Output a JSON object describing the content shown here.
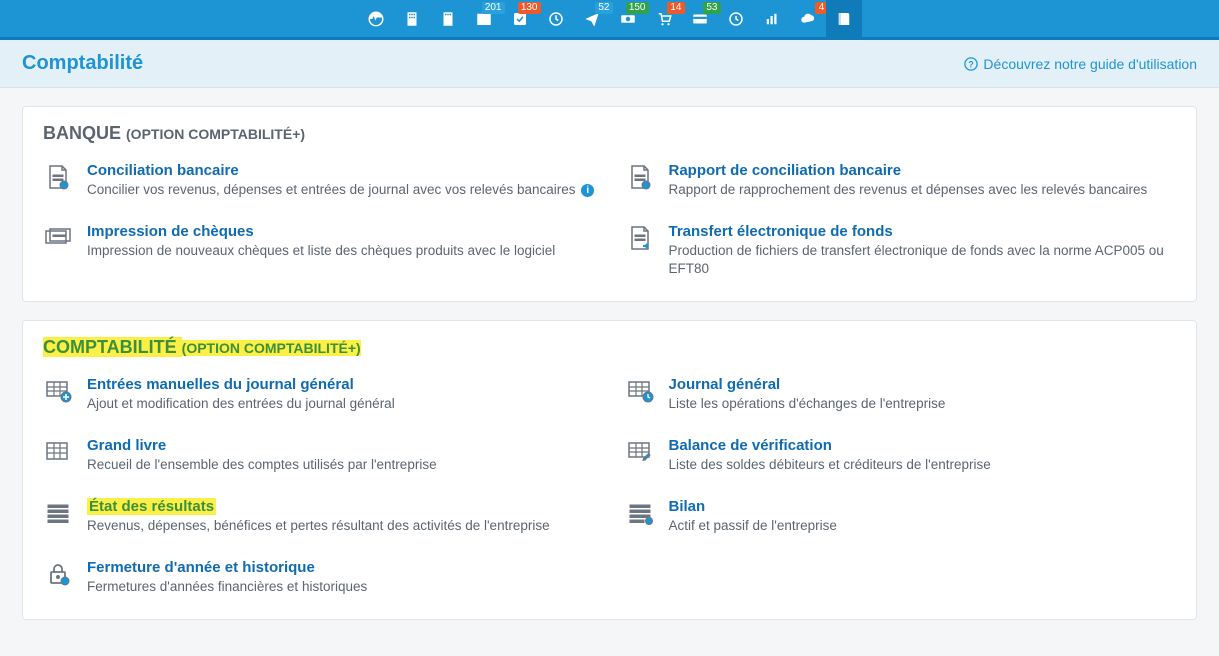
{
  "topbar": {
    "items": [
      {
        "icon": "dashboard-icon",
        "badge": null
      },
      {
        "icon": "building-icon",
        "badge": null
      },
      {
        "icon": "building2-icon",
        "badge": null
      },
      {
        "icon": "inbox-icon",
        "badge": "201",
        "badgeColor": "blue"
      },
      {
        "icon": "check-icon",
        "badge": "130"
      },
      {
        "icon": "clock-icon",
        "badge": null
      },
      {
        "icon": "send-icon",
        "badge": "52",
        "badgeColor": "blue"
      },
      {
        "icon": "money-icon",
        "badge": "150",
        "badgeColor": "green"
      },
      {
        "icon": "cart-icon",
        "badge": "14"
      },
      {
        "icon": "card-icon",
        "badge": "53",
        "badgeColor": "green"
      },
      {
        "icon": "clock2-icon",
        "badge": null
      },
      {
        "icon": "chart-icon",
        "badge": null
      },
      {
        "icon": "cloud-icon",
        "badge": "4"
      },
      {
        "icon": "book-icon",
        "badge": null,
        "active": true
      }
    ]
  },
  "header": {
    "title": "Comptabilité",
    "guide": "Découvrez notre guide d'utilisation"
  },
  "sections": [
    {
      "title_main": "BANQUE",
      "title_sub": "(OPTION COMPTABILITÉ+)",
      "highlighted": false,
      "items": [
        {
          "icon": "doc-icon",
          "title": "Conciliation bancaire",
          "desc": "Concilier vos revenus, dépenses et entrées de journal avec vos relevés bancaires",
          "info": true
        },
        {
          "icon": "doc-icon",
          "title": "Rapport de conciliation bancaire",
          "desc": "Rapport de rapprochement des revenus et dépenses avec les relevés bancaires"
        },
        {
          "icon": "cheque-icon",
          "title": "Impression de chèques",
          "desc": "Impression de nouveaux chèques et liste des chèques produits avec le logiciel"
        },
        {
          "icon": "doc-arrow-icon",
          "title": "Transfert électronique de fonds",
          "desc": "Production de fichiers de transfert électronique de fonds avec la norme ACP005 ou EFT80"
        }
      ]
    },
    {
      "title_main": "COMPTABILITÉ",
      "title_sub": "(OPTION COMPTABILITÉ+)",
      "highlighted": true,
      "items": [
        {
          "icon": "grid-plus-icon",
          "title": "Entrées manuelles du journal général",
          "desc": "Ajout et modification des entrées du journal général"
        },
        {
          "icon": "grid-clock-icon",
          "title": "Journal général",
          "desc": "Liste les opérations d'échanges de l'entreprise"
        },
        {
          "icon": "grid-icon",
          "title": "Grand livre",
          "desc": "Recueil de l'ensemble des comptes utilisés par l'entreprise"
        },
        {
          "icon": "grid-edit-icon",
          "title": "Balance de vérification",
          "desc": "Liste des soldes débiteurs et créditeurs de l'entreprise"
        },
        {
          "icon": "lines-icon",
          "title": "État des résultats",
          "desc": "Revenus, dépenses, bénéfices et pertes résultant des activités de l'entreprise",
          "highlighted": true
        },
        {
          "icon": "lines2-icon",
          "title": "Bilan",
          "desc": "Actif et passif de l'entreprise"
        },
        {
          "icon": "lock-icon",
          "title": "Fermeture d'année et historique",
          "desc": "Fermetures d'années financières et historiques"
        }
      ]
    }
  ]
}
